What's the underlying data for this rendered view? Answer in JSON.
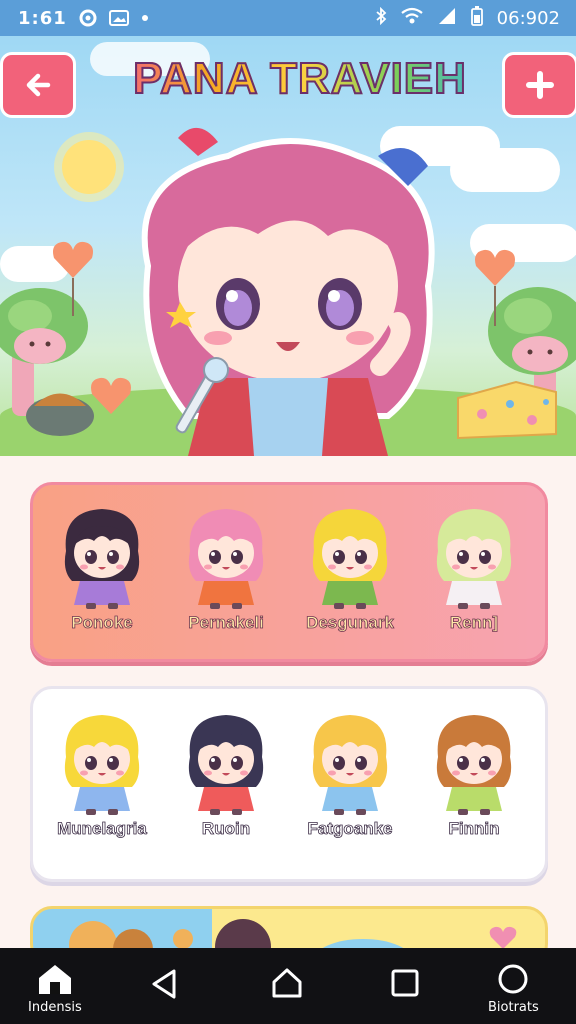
{
  "status_bar": {
    "time": "1:61",
    "clock": "06:902"
  },
  "header": {
    "title": "PANA TRAVIEH",
    "back_icon": "arrow-left-icon",
    "add_icon": "plus-icon"
  },
  "colors": {
    "nav_button": "#f2627a",
    "status": "#5b9ed8",
    "row1": "#f9a184",
    "row2": "#ffffff"
  },
  "rows": [
    {
      "characters": [
        {
          "name": "Ponoke",
          "hair": "#3b2a3f",
          "outfit": "#a77bd8"
        },
        {
          "name": "Pernakeli",
          "hair": "#f08cb5",
          "outfit": "#f0743f"
        },
        {
          "name": "Desgunark",
          "hair": "#f5d63a",
          "outfit": "#7cb84f"
        },
        {
          "name": "Renn]",
          "hair": "#d6ea9a",
          "outfit": "#f5f0f3"
        }
      ]
    },
    {
      "characters": [
        {
          "name": "Munelagria",
          "hair": "#f7d83a",
          "outfit": "#8eb6ee"
        },
        {
          "name": "Ruoin",
          "hair": "#3a3654",
          "outfit": "#ef5b5b"
        },
        {
          "name": "Fatgoanke",
          "hair": "#f7c64a",
          "outfit": "#8cc4ee"
        },
        {
          "name": "Finnin",
          "hair": "#c97a3a",
          "outfit": "#b9dc6a"
        }
      ]
    }
  ],
  "bottom_nav": {
    "left_label": "Indensis",
    "right_label": "Biotrats"
  }
}
